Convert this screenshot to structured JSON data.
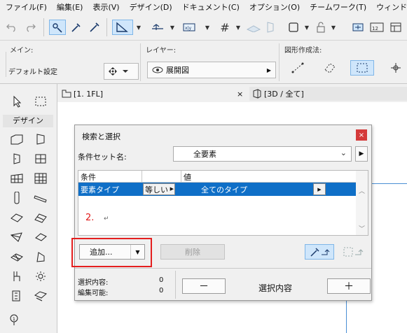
{
  "menu": [
    "ファイル(F)",
    "編集(E)",
    "表示(V)",
    "デザイン(D)",
    "ドキュメント(C)",
    "オプション(O)",
    "チームワーク(T)",
    "ウィンドウ(W)"
  ],
  "infobox": {
    "main_label": "メイン:",
    "main_value": "デフォルト設定",
    "layer_label": "レイヤー:",
    "layer_value": "展開図",
    "geometry_label": "図形作成法:"
  },
  "tabs": {
    "plan": "[1. 1FL]",
    "close": "×",
    "three_d": "[3D / 全て]"
  },
  "toolbox": {
    "title": "デザイン"
  },
  "dialog": {
    "title": "検索と選択",
    "close": "×",
    "criteria_set_label": "条件セット名:",
    "criteria_set_value": "全要素",
    "table_headers": {
      "criterion": "条件",
      "value": "値"
    },
    "row": {
      "criterion": "要素タイプ",
      "operator": "等しい",
      "value": "全てのタイプ"
    },
    "annotation": "2.",
    "add_label": "追加...",
    "delete_label": "削除",
    "selection_count_label": "選択内容:",
    "selection_count": "0",
    "editable_label": "編集可能:",
    "editable_count": "0",
    "minus_label": "－",
    "selection_label": "選択内容",
    "plus_label": "＋"
  },
  "colors": {
    "selected_row": "#0f6fc7",
    "annotation_red": "#e41f1f",
    "highlight_blue": "#cfe6fb"
  }
}
